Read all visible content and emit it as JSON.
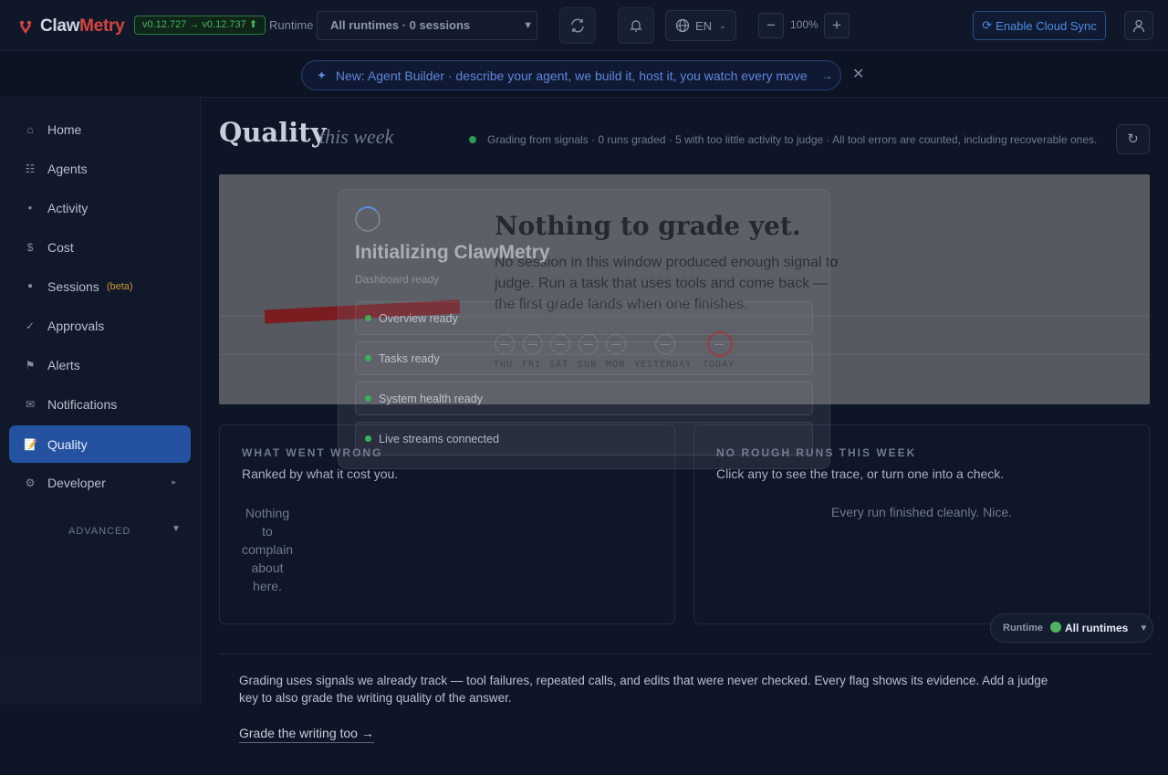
{
  "header": {
    "logo_claw": "Claw",
    "logo_metry": "Metry",
    "version": "v0.12.727 → v0.12.737 ⬆",
    "runtime_label": "Runtime",
    "runtime_select": "All runtimes · 0 sessions",
    "language": "EN",
    "zoom": "100%",
    "zoom_out": "−",
    "zoom_in": "+",
    "cloud_sync": "Enable Cloud Sync"
  },
  "banner": {
    "text": "New: Agent Builder · describe your agent, we build it, host it, you watch every move",
    "arrow": "→",
    "close": "✕"
  },
  "sidebar": {
    "items": [
      {
        "label": "Home",
        "icon": "⌂"
      },
      {
        "label": "Agents",
        "icon": "☷"
      },
      {
        "label": "Activity",
        "icon": "●"
      },
      {
        "label": "Cost",
        "icon": "$"
      },
      {
        "label": "Sessions",
        "icon": "●",
        "badge": "(beta)"
      },
      {
        "label": "Approvals",
        "icon": "✓"
      },
      {
        "label": "Alerts",
        "icon": "⚑"
      },
      {
        "label": "Notifications",
        "icon": "✉"
      },
      {
        "label": "Quality",
        "icon": "📝"
      },
      {
        "label": "Developer",
        "icon": "⚙"
      }
    ],
    "advanced": "ADVANCED",
    "advanced_caret": "▼",
    "developer_caret": "▸"
  },
  "page": {
    "title": "Quality",
    "subtitle": "this week",
    "status": "Grading from signals · 0 runs graded · 5 with too little activity to judge · All tool errors are counted, including recoverable ones.",
    "refresh": "↻"
  },
  "hero": {
    "title": "Nothing to grade yet.",
    "text": "No session in this window produced enough signal to judge. Run a task that uses tools and come back — the first grade lands when one finishes.",
    "days": [
      "THU",
      "FRI",
      "SAT",
      "SUN",
      "MON",
      "YESTERDAY",
      "TODAY"
    ]
  },
  "cards": {
    "wrong_title": "WHAT WENT WRONG",
    "wrong_sub": "Ranked by what it cost you.",
    "wrong_empty": "Nothing to complain about here.",
    "rough_title": "NO ROUGH RUNS THIS WEEK",
    "rough_sub": "Click any to see the trace, or turn one into a check.",
    "rough_empty": "Every run finished cleanly. Nice."
  },
  "footer": {
    "text": "Grading uses signals we already track — tool failures, repeated calls, and edits that were never checked. Every flag shows its evidence. Add a judge key to also grade the writing quality of the answer.",
    "link": "Grade the writing too →"
  },
  "runtime_pill": {
    "label": "Runtime",
    "value": "All runtimes",
    "caret": "▼"
  },
  "loading": {
    "title": "Initializing ClawMetry",
    "subtitle": "Dashboard ready",
    "steps": [
      "Overview ready",
      "Tasks ready",
      "System health ready",
      "Live streams connected"
    ]
  },
  "colors": {
    "accent": "#2452a1",
    "brand_red": "#d7453f",
    "ok_green": "#3fae55",
    "cloud_blue": "#4e8be0"
  }
}
